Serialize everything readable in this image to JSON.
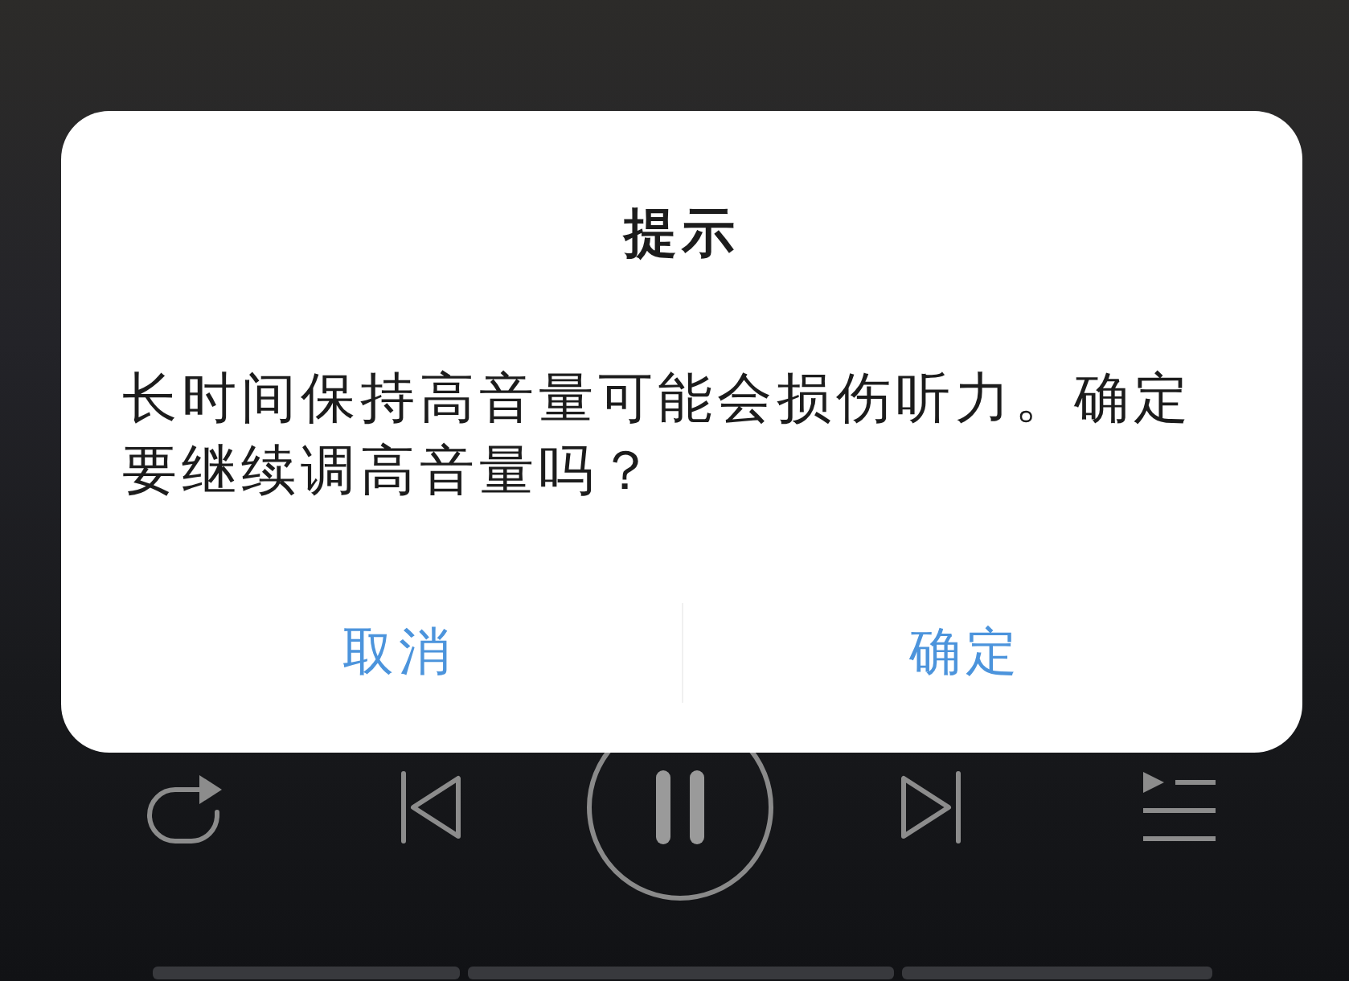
{
  "dialog": {
    "title": "提示",
    "message": "长时间保持高音量可能会损伤听力。确定要继续调高音量吗？",
    "buttons": [
      "取消",
      "确定"
    ]
  },
  "player": {
    "playing": true
  }
}
